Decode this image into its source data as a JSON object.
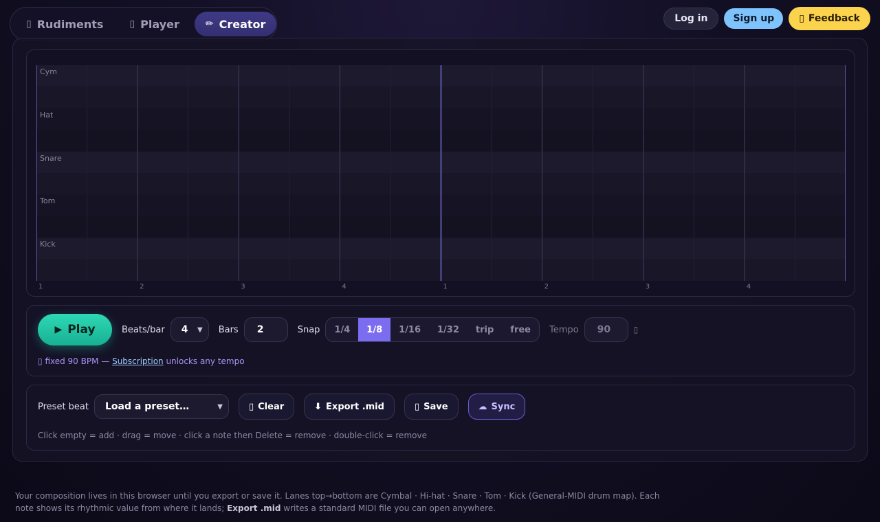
{
  "nav": {
    "tabs": [
      {
        "icon": "drum-icon",
        "glyph": "▯",
        "label": "Rudiments"
      },
      {
        "icon": "player-icon",
        "glyph": "▯",
        "label": "Player"
      },
      {
        "icon": "pencil-icon",
        "glyph": "✏",
        "label": "Creator"
      }
    ]
  },
  "top_actions": {
    "login": "Log in",
    "signup": "Sign up",
    "feedback_glyph": "▯",
    "feedback": "Feedback"
  },
  "grid": {
    "lanes": [
      "Cym",
      "Hat",
      "Snare",
      "Tom",
      "Kick"
    ],
    "beat_labels": [
      "1",
      "2",
      "3",
      "4",
      "1",
      "2",
      "3",
      "4"
    ]
  },
  "controls": {
    "play_glyph": "▶",
    "play": "Play",
    "beats_label": "Beats/bar",
    "beats_value": "4",
    "bars_label": "Bars",
    "bars_value": "2",
    "snap_label": "Snap",
    "snap_options": [
      "1/4",
      "1/8",
      "1/16",
      "1/32",
      "trip",
      "free"
    ],
    "snap_selected": "1/8",
    "tempo_label": "Tempo",
    "tempo_value": "90",
    "lock_glyph": "▯",
    "note_glyph": "▯",
    "note_prefix": "fixed 90 BPM — ",
    "note_link": "Subscription",
    "note_suffix": " unlocks any tempo"
  },
  "preset": {
    "label": "Preset beat",
    "select_value": "Load a preset…",
    "clear_glyph": "▯",
    "clear": "Clear",
    "export_glyph": "⬇",
    "export": "Export .mid",
    "save_glyph": "▯",
    "save": "Save",
    "sync_glyph": "☁",
    "sync": "Sync",
    "help": "Click empty = add · drag = move · click a note then Delete = remove · double-click = remove"
  },
  "footer": {
    "text1": "Your composition lives in this browser until you export or save it. Lanes top→bottom are Cymbal · Hi-hat · Snare · Tom · Kick (General-MIDI drum map). Each note shows its rhythmic value from where it lands; ",
    "bold": "Export .mid",
    "text2": " writes a standard MIDI file you can open anywhere."
  }
}
